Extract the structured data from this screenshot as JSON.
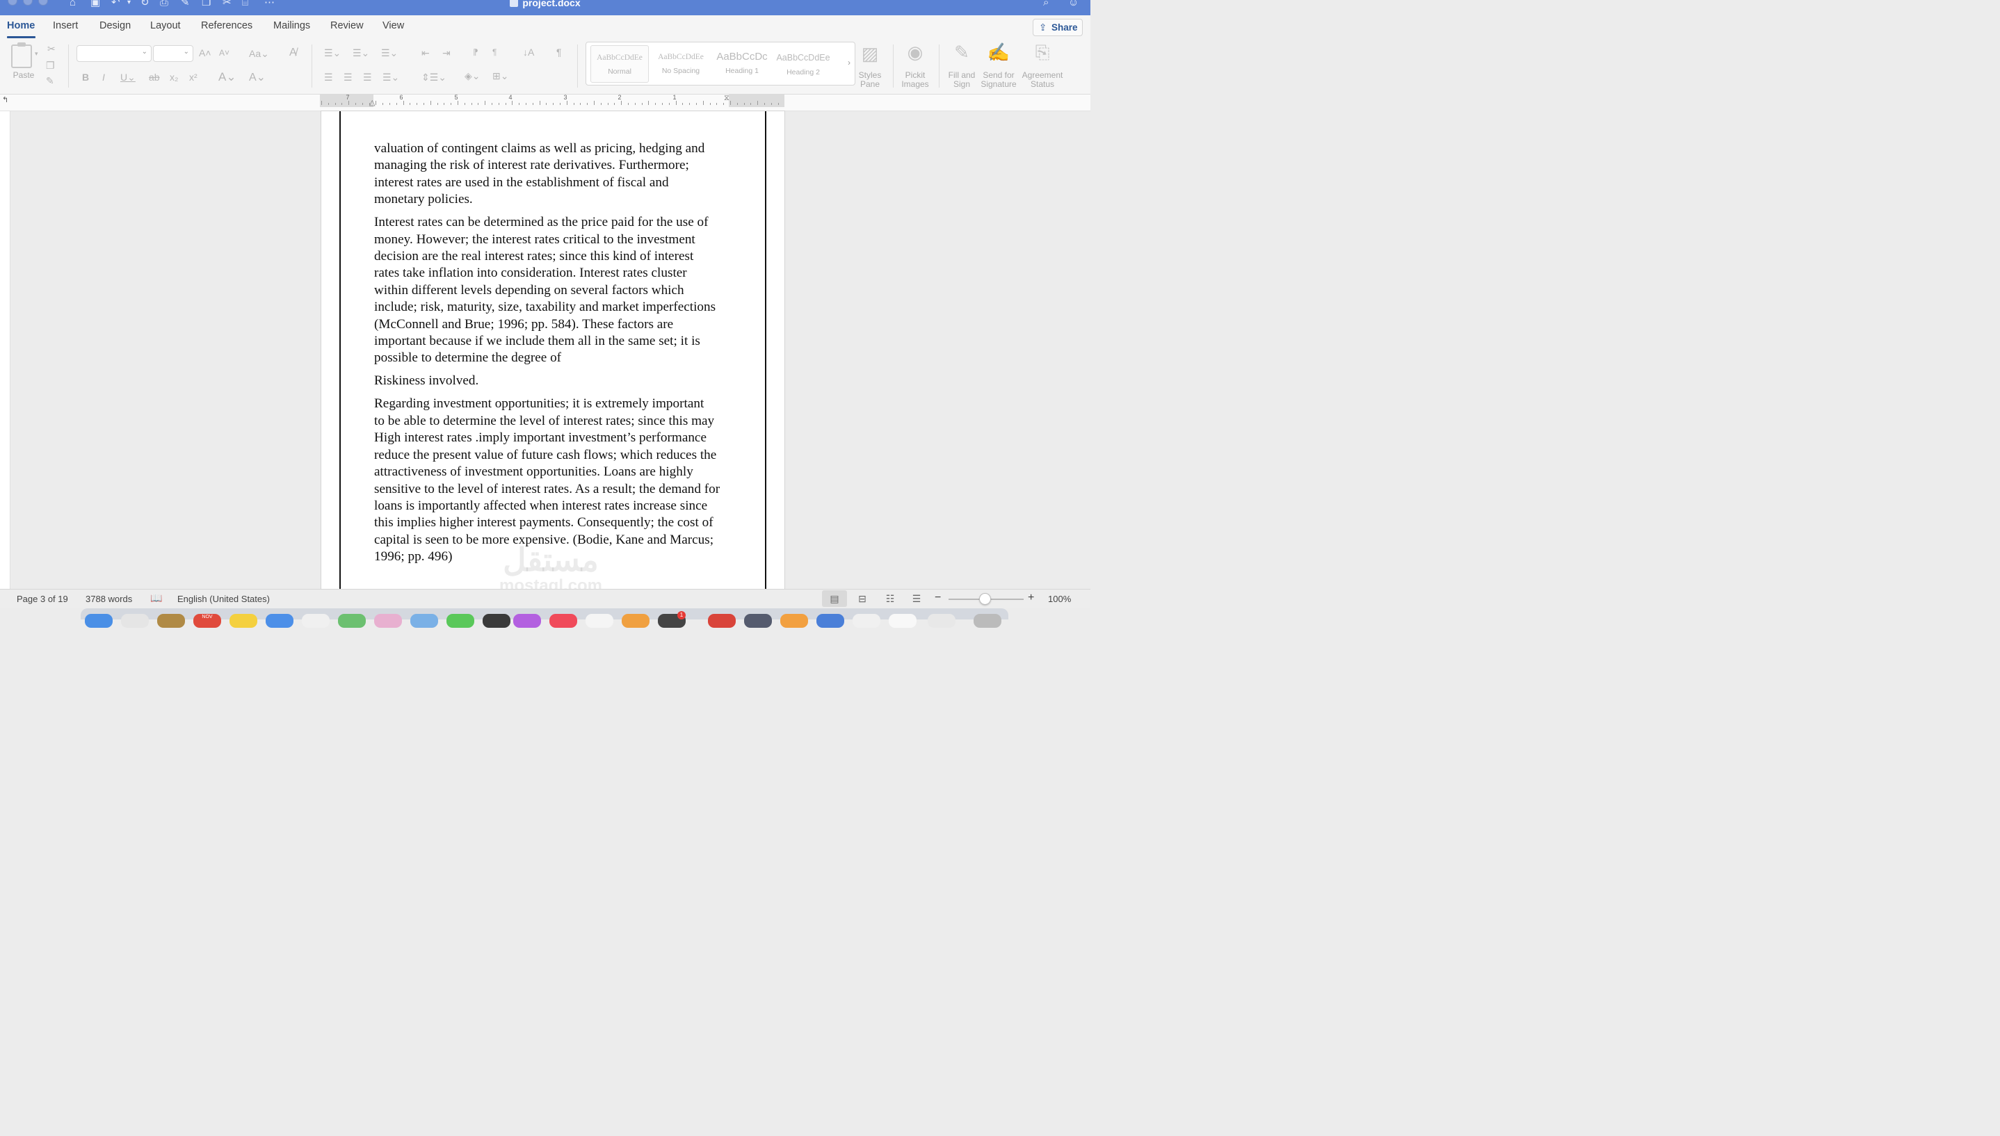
{
  "window": {
    "title": "project.docx"
  },
  "tabs": [
    {
      "label": "Home",
      "active": true
    },
    {
      "label": "Insert"
    },
    {
      "label": "Design"
    },
    {
      "label": "Layout"
    },
    {
      "label": "References"
    },
    {
      "label": "Mailings"
    },
    {
      "label": "Review"
    },
    {
      "label": "View"
    }
  ],
  "share": {
    "label": "Share"
  },
  "ribbon": {
    "paste_label": "Paste",
    "font_name": "",
    "font_size": "",
    "styles": [
      {
        "sample": "AaBbCcDdEe",
        "name": "Normal"
      },
      {
        "sample": "AaBbCcDdEe",
        "name": "No Spacing"
      },
      {
        "sample": "AaBbCcDc",
        "name": "Heading 1"
      },
      {
        "sample": "AaBbCcDdEe",
        "name": "Heading 2"
      }
    ],
    "styles_pane": [
      "Styles",
      "Pane"
    ],
    "pickit": [
      "Pickit",
      "Images"
    ],
    "fill_sign": [
      "Fill and",
      "Sign"
    ],
    "send_sig": [
      "Send for",
      "Signature"
    ],
    "agreement": [
      "Agreement",
      "Status"
    ]
  },
  "ruler": {
    "numbers": [
      "7",
      "6",
      "5",
      "4",
      "3",
      "2",
      "1"
    ]
  },
  "document": {
    "paragraphs": [
      [
        "valuation of contingent claims as well as pricing, hedging and",
        "managing the risk of interest rate derivatives. Furthermore;",
        "interest rates are used in the establishment of fiscal and",
        "monetary policies."
      ],
      [
        "Interest rates can be determined as the price paid for the use of",
        "money. However; the interest rates critical to the investment",
        "decision are the real interest rates; since this kind of interest",
        "rates take inflation into consideration. Interest rates cluster",
        "within different levels depending on several factors which",
        "include; risk, maturity, size, taxability and market imperfections",
        "(McConnell and Brue; 1996; pp. 584). These factors are",
        "important because if we include them all in the same set; it is",
        "possible to determine the degree of"
      ],
      [
        "Riskiness involved."
      ],
      [
        "Regarding investment opportunities; it is extremely important",
        "to be able to determine the level of interest rates; since this may",
        "High interest rates .imply important investment’s performance",
        "reduce the present value of future cash flows; which reduces the",
        "attractiveness of investment opportunities. Loans are highly",
        "sensitive to the level of interest rates. As a result; the demand for",
        "loans is importantly affected when interest rates increase since",
        "this implies higher interest payments. Consequently; the cost of",
        "capital is seen to be more expensive. (Bodie, Kane and Marcus;",
        "1996; pp. 496)"
      ]
    ],
    "watermark": {
      "arabic": "مستقل",
      "latin": "mostaql.com"
    }
  },
  "status": {
    "page": "Page 3 of 19",
    "words": "3788 words",
    "language": "English (United States)",
    "zoom": "100%",
    "zoom_level": 1.0
  },
  "dock": {
    "calendar_month": "NOV",
    "badge": "1"
  },
  "colors": {
    "titlebar": "#5a82d4",
    "accent": "#2b5796"
  }
}
